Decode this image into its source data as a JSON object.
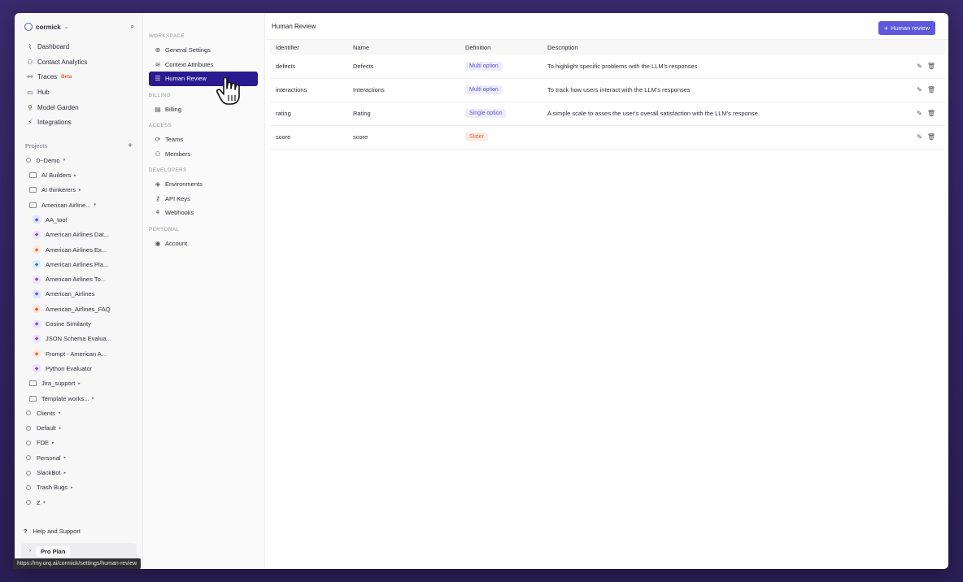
{
  "org": {
    "name": "cormick"
  },
  "sidebar": {
    "nav": [
      {
        "label": "Dashboard",
        "icon": "chart-icon"
      },
      {
        "label": "Contact Analytics",
        "icon": "users-icon"
      },
      {
        "label": "Traces",
        "icon": "traces-icon",
        "badge": "Beta"
      },
      {
        "label": "Hub",
        "icon": "hub-icon"
      },
      {
        "label": "Model Garden",
        "icon": "model-garden-icon"
      },
      {
        "label": "Integrations",
        "icon": "integrations-icon"
      }
    ],
    "projects_label": "Projects",
    "tree": [
      {
        "label": "0~Demo",
        "kind": "bullet",
        "level": 0,
        "arrow": "▾"
      },
      {
        "label": "AI Builders",
        "kind": "folder",
        "level": 1,
        "arrow": "▸"
      },
      {
        "label": "AI thinkerers",
        "kind": "folder",
        "level": 1,
        "arrow": "▸"
      },
      {
        "label": "American Airline...",
        "kind": "folder",
        "level": 1,
        "arrow": "▾"
      },
      {
        "label": "AA_tool",
        "kind": "chip",
        "color": "#dfe6ff",
        "fg": "#4a5bd1",
        "level": 2
      },
      {
        "label": "American Airlines Dat...",
        "kind": "chip",
        "color": "#efe3ff",
        "fg": "#8a48d6",
        "level": 2
      },
      {
        "label": "American Airlines Ex...",
        "kind": "chip",
        "color": "#ffe8dc",
        "fg": "#d66a3d",
        "level": 2
      },
      {
        "label": "American Airlines Pla...",
        "kind": "chip",
        "color": "#dceefa",
        "fg": "#3a7fb8",
        "level": 2
      },
      {
        "label": "American Airlines To...",
        "kind": "chip",
        "color": "#efe3ff",
        "fg": "#8a48d6",
        "level": 2
      },
      {
        "label": "American_Airlines",
        "kind": "chip",
        "color": "#e4e6ff",
        "fg": "#5b57d1",
        "level": 2
      },
      {
        "label": "American_Airlines_FAQ",
        "kind": "chip",
        "color": "#ffe4dc",
        "fg": "#d6563d",
        "level": 2
      },
      {
        "label": "Cosine Similarity",
        "kind": "chip",
        "color": "#efe3ff",
        "fg": "#8a48d6",
        "level": 2
      },
      {
        "label": "JSON Schema Evalua...",
        "kind": "chip",
        "color": "#efe3ff",
        "fg": "#8a48d6",
        "level": 2
      },
      {
        "label": "Prompt - American A...",
        "kind": "chip",
        "color": "#ffe8dc",
        "fg": "#d66a3d",
        "level": 2
      },
      {
        "label": "Python Evaluator",
        "kind": "chip",
        "color": "#efe3ff",
        "fg": "#8a48d6",
        "level": 2
      },
      {
        "label": "Jira_support",
        "kind": "folder",
        "level": 1,
        "arrow": "▸"
      },
      {
        "label": "Template works...",
        "kind": "folder",
        "level": 1,
        "arrow": "▸"
      },
      {
        "label": "Clients",
        "kind": "bullet",
        "level": 0,
        "arrow": "▸"
      },
      {
        "label": "Default",
        "kind": "bullet",
        "level": 0,
        "arrow": "▸"
      },
      {
        "label": "FDE",
        "kind": "bullet",
        "level": 0,
        "arrow": "▸"
      },
      {
        "label": "Personal",
        "kind": "bullet",
        "level": 0,
        "arrow": "▸"
      },
      {
        "label": "SlackBot",
        "kind": "bullet",
        "level": 0,
        "arrow": "▸"
      },
      {
        "label": "Trash Bugs",
        "kind": "bullet",
        "level": 0,
        "arrow": "▸"
      },
      {
        "label": "Z",
        "kind": "bullet",
        "level": 0,
        "arrow": "▸"
      }
    ],
    "help": "Help and Support",
    "plan": "Pro Plan"
  },
  "settings": {
    "sections": [
      {
        "title": "WORKSPACE",
        "items": [
          {
            "label": "General Settings",
            "icon": "globe-icon"
          },
          {
            "label": "Context Attributes",
            "icon": "database-icon"
          },
          {
            "label": "Human Review",
            "icon": "list-icon",
            "active": true
          }
        ]
      },
      {
        "title": "BILLING",
        "items": [
          {
            "label": "Billing",
            "icon": "receipt-icon"
          }
        ]
      },
      {
        "title": "ACCESS",
        "items": [
          {
            "label": "Teams",
            "icon": "teams-icon"
          },
          {
            "label": "Members",
            "icon": "members-icon"
          }
        ]
      },
      {
        "title": "DEVELOPERS",
        "items": [
          {
            "label": "Environments",
            "icon": "environments-icon"
          },
          {
            "label": "API Keys",
            "icon": "key-icon"
          },
          {
            "label": "Webhooks",
            "icon": "webhook-icon"
          }
        ]
      },
      {
        "title": "PERSONAL",
        "items": [
          {
            "label": "Account",
            "icon": "account-icon"
          }
        ]
      }
    ]
  },
  "main": {
    "title": "Human Review",
    "add_button": "Human review",
    "columns": [
      "Identifier",
      "Name",
      "Definition",
      "Description"
    ],
    "rows": [
      {
        "identifier": "defects",
        "name": "Defects",
        "definition": "Multi option",
        "def_kind": "multi",
        "description": "To highlight specific problems with the LLM's responses"
      },
      {
        "identifier": "interactions",
        "name": "Interactions",
        "definition": "Multi option",
        "def_kind": "multi",
        "description": "To track how users interact with the LLM's responses"
      },
      {
        "identifier": "rating",
        "name": "Rating",
        "definition": "Single option",
        "def_kind": "single",
        "description": "A simple scale to asses the user's overall satisfaction with the LLM's response."
      },
      {
        "identifier": "score",
        "name": "score",
        "definition": "Slider",
        "def_kind": "slider",
        "description": ""
      }
    ]
  },
  "status_url": "https://my.orq.ai/cormick/settings/human-review"
}
